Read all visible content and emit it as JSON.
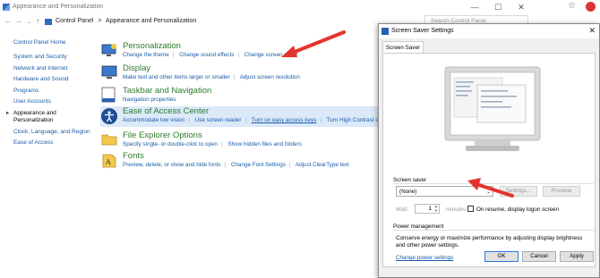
{
  "control_panel": {
    "title": "Appearance and Personalization",
    "breadcrumb": [
      "Control Panel",
      ">",
      "Appearance and Personalization"
    ],
    "search_placeholder": "Search Control Panel",
    "sidebar": [
      {
        "label": "Control Panel Home"
      },
      {
        "label": "System and Security"
      },
      {
        "label": "Network and Internet"
      },
      {
        "label": "Hardware and Sound"
      },
      {
        "label": "Programs"
      },
      {
        "label": "User Accounts"
      },
      {
        "label": "Appearance and Personalization"
      },
      {
        "label": "Clock, Language, and Region"
      },
      {
        "label": "Ease of Access"
      }
    ],
    "categories": [
      {
        "title": "Personalization",
        "links": [
          "Change the theme",
          "Change sound effects",
          "Change screen saver"
        ]
      },
      {
        "title": "Display",
        "links": [
          "Make text and other items larger or smaller",
          "Adjust screen resolution"
        ]
      },
      {
        "title": "Taskbar and Navigation",
        "links": [
          "Navigation properties"
        ]
      },
      {
        "title": "Ease of Access Center",
        "links": [
          "Accommodate low vision",
          "Use screen reader",
          "Turn on easy access keys",
          "Turn High Contrast on"
        ]
      },
      {
        "title": "File Explorer Options",
        "links": [
          "Specify single- or double-click to open",
          "Show hidden files and folders"
        ]
      },
      {
        "title": "Fonts",
        "links": [
          "Preview, delete, or show and hide fonts",
          "Change Font Settings",
          "Adjust ClearType text"
        ]
      }
    ]
  },
  "dialog": {
    "title": "Screen Saver Settings",
    "tab": "Screen Saver",
    "screen_saver_group": "Screen saver",
    "selected": "(None)",
    "settings_button": "Settings...",
    "preview_button": "Preview",
    "wait_label": "Wait:",
    "wait_value": "1",
    "minutes_label": "minutes",
    "resume_label": "On resume, display logon screen",
    "power_group": "Power management",
    "power_text": "Conserve energy or maximize performance by adjusting display brightness and other power settings.",
    "power_link": "Change power settings",
    "ok": "OK",
    "cancel": "Cancel",
    "apply": "Apply"
  },
  "colors": {
    "link": "#1a5ca8",
    "category_title": "#2c7c2c",
    "arrow": "#e3342f",
    "highlight": "#dbe9f9"
  }
}
